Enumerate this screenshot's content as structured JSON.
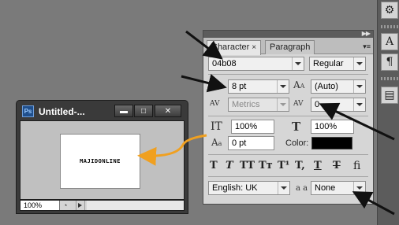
{
  "document": {
    "title": "Untitled-...",
    "app_badge": "Ps",
    "canvas_text": "MAJIDONLINE",
    "zoom": "100%",
    "window_buttons": {
      "minimize": "▬",
      "maximize": "□",
      "close": "✕"
    }
  },
  "panel": {
    "tabs": [
      {
        "label": "Character",
        "close": "×",
        "active": true
      },
      {
        "label": "Paragraph",
        "active": false
      }
    ],
    "font_family": "04b08",
    "font_style": "Regular",
    "font_size": "8 pt",
    "leading": "(Auto)",
    "kerning": "Metrics",
    "tracking": "0",
    "vertical_scale": "100%",
    "horizontal_scale": "100%",
    "baseline_shift": "0 pt",
    "color_label": "Color:",
    "color_value": "#000000",
    "style_buttons": [
      "T",
      "T",
      "TT",
      "Tт",
      "T¹",
      "T,",
      "T",
      "T",
      "ﬁ"
    ],
    "language": "English: UK",
    "anti_alias": "None",
    "anti_alias_icon": "a a"
  },
  "dock": {
    "icons": [
      "character-panel-icon",
      "paragraph-panel-icon",
      "notes-icon"
    ],
    "glyphs": [
      "A",
      "¶",
      "▤"
    ]
  }
}
